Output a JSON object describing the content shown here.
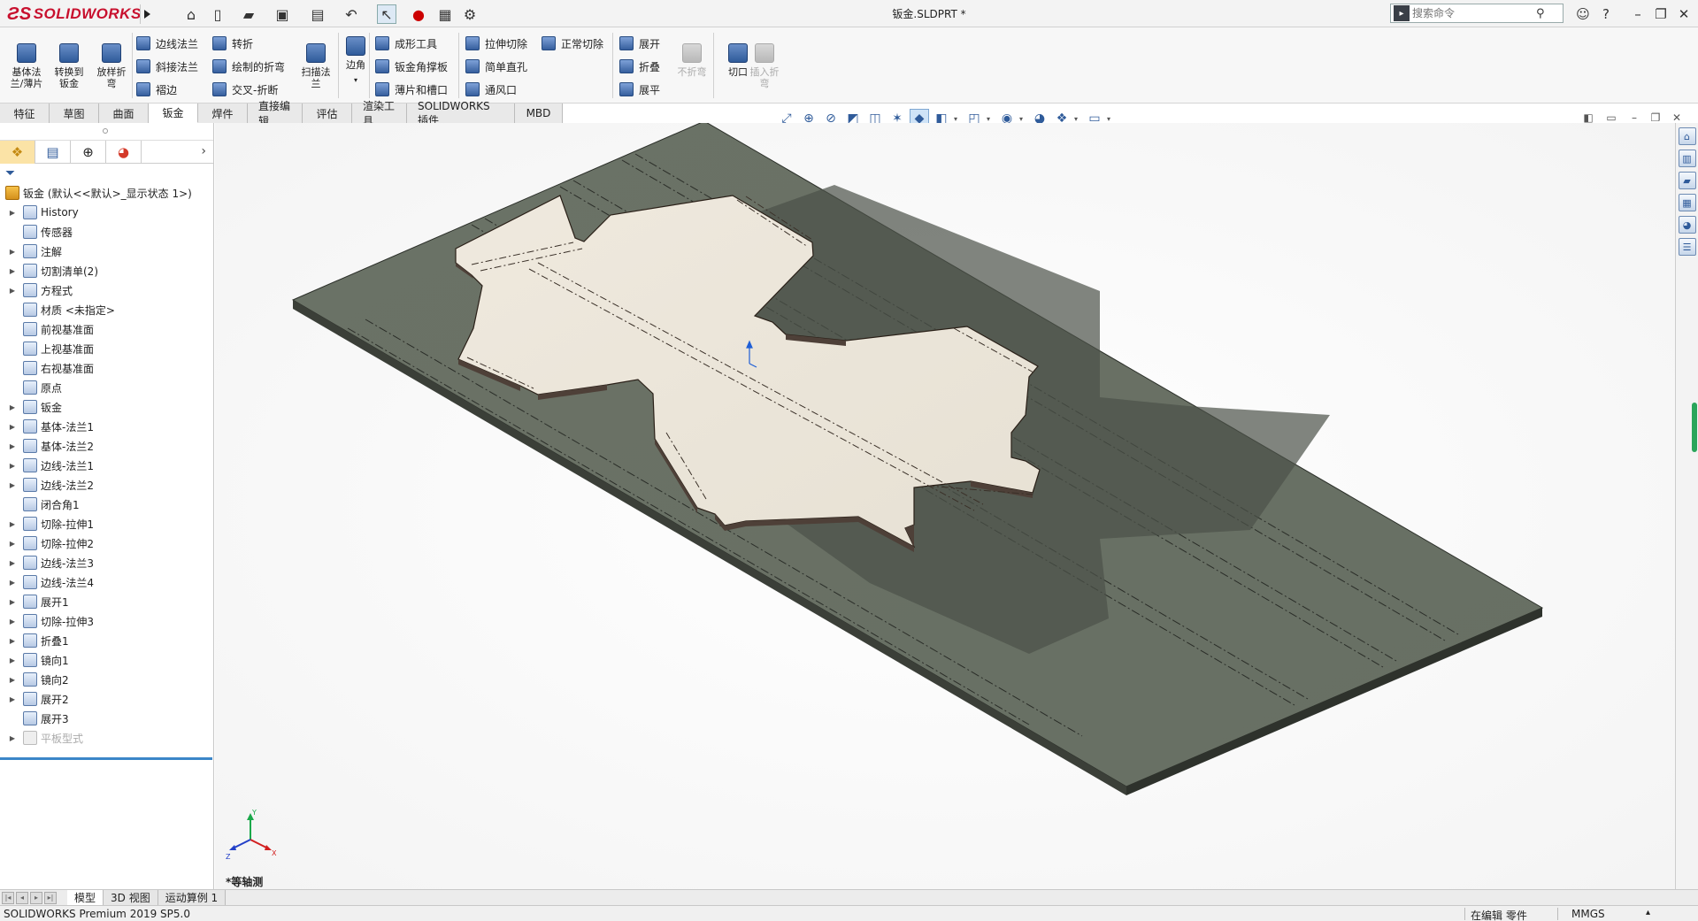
{
  "app": {
    "brand": "SOLIDWORKS",
    "document_title": "钣金.SLDPRT *",
    "search_placeholder": "搜索命令",
    "help_label": "?"
  },
  "command_manager": {
    "big_buttons": [
      {
        "label": "基体法\n兰/薄片",
        "icon": "base-flange-icon"
      },
      {
        "label": "转换到\n钣金",
        "icon": "convert-sheet-metal-icon"
      },
      {
        "label": "放样折\n弯",
        "icon": "lofted-bend-icon"
      }
    ],
    "col1": [
      "边线法兰",
      "斜接法兰",
      "褶边"
    ],
    "col2": [
      "转折",
      "绘制的折弯",
      "交叉-折断"
    ],
    "sweep_flange": "扫描法\n兰",
    "corner": "边角",
    "col3": [
      "成形工具",
      "钣金角撑板",
      "薄片和槽口"
    ],
    "col4": [
      "拉伸切除",
      "简单直孔",
      "通风口"
    ],
    "col5": [
      "正常切除"
    ],
    "col6": [
      "展开",
      "折叠",
      "展平"
    ],
    "no_bend": "不折弯",
    "rip": "切口",
    "insert_bend": "插入折\n弯"
  },
  "tabs": [
    "特征",
    "草图",
    "曲面",
    "钣金",
    "焊件",
    "直接编辑",
    "评估",
    "渲染工具",
    "SOLIDWORKS 插件",
    "MBD"
  ],
  "active_tab": 3,
  "feature_tree": {
    "root": "钣金 (默认<<默认>_显示状态 1>)",
    "items": [
      {
        "label": "History",
        "expandable": true
      },
      {
        "label": "传感器",
        "expandable": false
      },
      {
        "label": "注解",
        "expandable": true
      },
      {
        "label": "切割清单(2)",
        "expandable": true
      },
      {
        "label": "方程式",
        "expandable": true
      },
      {
        "label": "材质 <未指定>",
        "expandable": false
      },
      {
        "label": "前视基准面",
        "expandable": false
      },
      {
        "label": "上视基准面",
        "expandable": false
      },
      {
        "label": "右视基准面",
        "expandable": false
      },
      {
        "label": "原点",
        "expandable": false
      },
      {
        "label": "钣金",
        "expandable": true
      },
      {
        "label": "基体-法兰1",
        "expandable": true
      },
      {
        "label": "基体-法兰2",
        "expandable": true
      },
      {
        "label": "边线-法兰1",
        "expandable": true
      },
      {
        "label": "边线-法兰2",
        "expandable": true
      },
      {
        "label": "闭合角1",
        "expandable": false
      },
      {
        "label": "切除-拉伸1",
        "expandable": true
      },
      {
        "label": "切除-拉伸2",
        "expandable": true
      },
      {
        "label": "边线-法兰3",
        "expandable": true
      },
      {
        "label": "边线-法兰4",
        "expandable": true
      },
      {
        "label": "展开1",
        "expandable": true
      },
      {
        "label": "切除-拉伸3",
        "expandable": true
      },
      {
        "label": "折叠1",
        "expandable": true
      },
      {
        "label": "镜向1",
        "expandable": true
      },
      {
        "label": "镜向2",
        "expandable": true
      },
      {
        "label": "展开2",
        "expandable": true
      },
      {
        "label": "展开3",
        "expandable": false
      },
      {
        "label": "平板型式",
        "expandable": true,
        "suppressed": true
      }
    ]
  },
  "viewport": {
    "view_label": "*等轴测",
    "triad_axes": [
      "X",
      "Y",
      "Z"
    ]
  },
  "model_tabs": [
    "模型",
    "3D 视图",
    "运动算例 1"
  ],
  "active_model_tab": 0,
  "status": {
    "product": "SOLIDWORKS Premium 2019 SP5.0",
    "editing": "在编辑 零件",
    "units": "MMGS"
  },
  "colors": {
    "sheet": "#ece6da",
    "sheet_edge": "#4e4038",
    "plate": "#6f7669",
    "plate_edge": "#2c302a",
    "accent_blue": "#2f5b9a",
    "brand_red": "#c8102e"
  }
}
